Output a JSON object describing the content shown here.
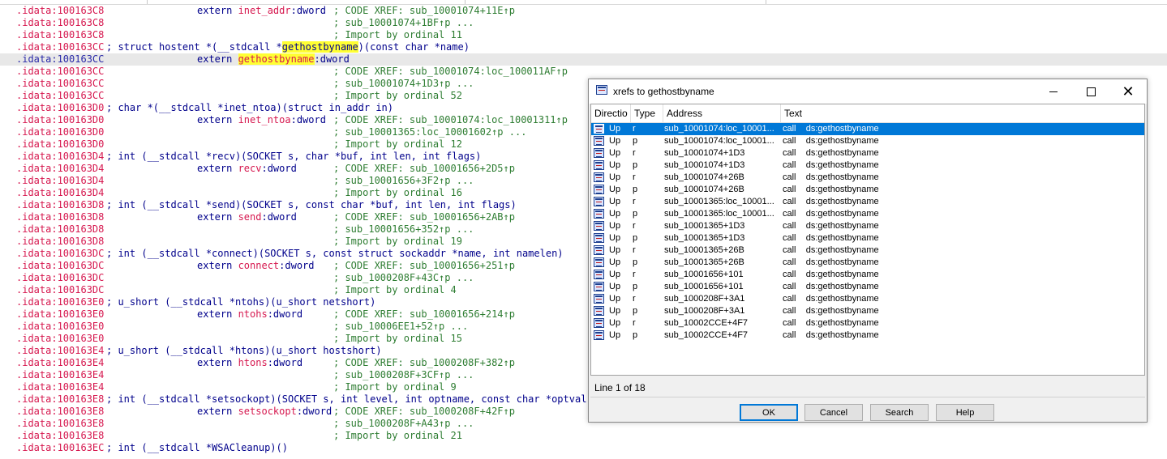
{
  "listing": {
    "lines": [
      {
        "type": "extern",
        "addr": ".idata:100163C8",
        "name": "inet_addr",
        "suffix": ":dword",
        "comment": "; CODE XREF: sub_10001074+11E↑p"
      },
      {
        "type": "cont",
        "addr": ".idata:100163C8",
        "comment": "; sub_10001074+1BF↑p ..."
      },
      {
        "type": "cont",
        "addr": ".idata:100163C8",
        "comment": "; Import by ordinal 11"
      },
      {
        "type": "decl",
        "addr": ".idata:100163CC",
        "pre": "; struct hostent *(__stdcall *",
        "mark": "gethostbyname",
        "post": ")(const char *name)"
      },
      {
        "type": "extern",
        "addr": ".idata:100163CC",
        "name": "gethostbyname",
        "suffix": ":dword",
        "comment": "",
        "current": true,
        "mark": true
      },
      {
        "type": "cont",
        "addr": ".idata:100163CC",
        "comment": "; CODE XREF: sub_10001074:loc_100011AF↑p"
      },
      {
        "type": "cont",
        "addr": ".idata:100163CC",
        "comment": "; sub_10001074+1D3↑p ..."
      },
      {
        "type": "cont",
        "addr": ".idata:100163CC",
        "comment": "; Import by ordinal 52"
      },
      {
        "type": "decl",
        "addr": ".idata:100163D0",
        "pre": "; char *(__stdcall *inet_ntoa)(struct in_addr in)"
      },
      {
        "type": "extern",
        "addr": ".idata:100163D0",
        "name": "inet_ntoa",
        "suffix": ":dword",
        "comment": "; CODE XREF: sub_10001074:loc_10001311↑p"
      },
      {
        "type": "cont",
        "addr": ".idata:100163D0",
        "comment": "; sub_10001365:loc_10001602↑p ..."
      },
      {
        "type": "cont",
        "addr": ".idata:100163D0",
        "comment": "; Import by ordinal 12"
      },
      {
        "type": "decl",
        "addr": ".idata:100163D4",
        "pre": "; int (__stdcall *recv)(SOCKET s, char *buf, int len, int flags)"
      },
      {
        "type": "extern",
        "addr": ".idata:100163D4",
        "name": "recv",
        "suffix": ":dword",
        "comment": "; CODE XREF: sub_10001656+2D5↑p"
      },
      {
        "type": "cont",
        "addr": ".idata:100163D4",
        "comment": "; sub_10001656+3F2↑p ..."
      },
      {
        "type": "cont",
        "addr": ".idata:100163D4",
        "comment": "; Import by ordinal 16"
      },
      {
        "type": "decl",
        "addr": ".idata:100163D8",
        "pre": "; int (__stdcall *send)(SOCKET s, const char *buf, int len, int flags)"
      },
      {
        "type": "extern",
        "addr": ".idata:100163D8",
        "name": "send",
        "suffix": ":dword",
        "comment": "; CODE XREF: sub_10001656+2AB↑p"
      },
      {
        "type": "cont",
        "addr": ".idata:100163D8",
        "comment": "; sub_10001656+352↑p ..."
      },
      {
        "type": "cont",
        "addr": ".idata:100163D8",
        "comment": "; Import by ordinal 19"
      },
      {
        "type": "decl",
        "addr": ".idata:100163DC",
        "pre": "; int (__stdcall *connect)(SOCKET s, const struct sockaddr *name, int namelen)"
      },
      {
        "type": "extern",
        "addr": ".idata:100163DC",
        "name": "connect",
        "suffix": ":dword",
        "comment": "; CODE XREF: sub_10001656+251↑p"
      },
      {
        "type": "cont",
        "addr": ".idata:100163DC",
        "comment": "; sub_1000208F+43C↑p ..."
      },
      {
        "type": "cont",
        "addr": ".idata:100163DC",
        "comment": "; Import by ordinal 4"
      },
      {
        "type": "decl",
        "addr": ".idata:100163E0",
        "pre": "; u_short (__stdcall *ntohs)(u_short netshort)"
      },
      {
        "type": "extern",
        "addr": ".idata:100163E0",
        "name": "ntohs",
        "suffix": ":dword",
        "comment": "; CODE XREF: sub_10001656+214↑p"
      },
      {
        "type": "cont",
        "addr": ".idata:100163E0",
        "comment": "; sub_10006EE1+52↑p ..."
      },
      {
        "type": "cont",
        "addr": ".idata:100163E0",
        "comment": "; Import by ordinal 15"
      },
      {
        "type": "decl",
        "addr": ".idata:100163E4",
        "pre": "; u_short (__stdcall *htons)(u_short hostshort)"
      },
      {
        "type": "extern",
        "addr": ".idata:100163E4",
        "name": "htons",
        "suffix": ":dword",
        "comment": "; CODE XREF: sub_1000208F+382↑p"
      },
      {
        "type": "cont",
        "addr": ".idata:100163E4",
        "comment": "; sub_1000208F+3CF↑p ..."
      },
      {
        "type": "cont",
        "addr": ".idata:100163E4",
        "comment": "; Import by ordinal 9"
      },
      {
        "type": "decl",
        "addr": ".idata:100163E8",
        "pre": "; int (__stdcall *setsockopt)(SOCKET s, int level, int optname, const char *optval, i"
      },
      {
        "type": "extern",
        "addr": ".idata:100163E8",
        "name": "setsockopt",
        "suffix": ":dword",
        "comment": "; CODE XREF: sub_1000208F+42F↑p"
      },
      {
        "type": "cont",
        "addr": ".idata:100163E8",
        "comment": "; sub_1000208F+A43↑p ..."
      },
      {
        "type": "cont",
        "addr": ".idata:100163E8",
        "comment": "; Import by ordinal 21"
      },
      {
        "type": "decl",
        "addr": ".idata:100163EC",
        "pre": "; int (__stdcall *WSACleanup)()"
      }
    ]
  },
  "dialog": {
    "title": "xrefs to gethostbyname",
    "columns": [
      "Directio",
      "Type",
      "Address",
      "Text"
    ],
    "rows": [
      {
        "dir": "Up",
        "type": "r",
        "address": "sub_10001074:loc_10001...",
        "text": "call    ds:gethostbyname",
        "selected": true
      },
      {
        "dir": "Up",
        "type": "p",
        "address": "sub_10001074:loc_10001...",
        "text": "call    ds:gethostbyname"
      },
      {
        "dir": "Up",
        "type": "r",
        "address": "sub_10001074+1D3",
        "text": "call    ds:gethostbyname"
      },
      {
        "dir": "Up",
        "type": "p",
        "address": "sub_10001074+1D3",
        "text": "call    ds:gethostbyname"
      },
      {
        "dir": "Up",
        "type": "r",
        "address": "sub_10001074+26B",
        "text": "call    ds:gethostbyname"
      },
      {
        "dir": "Up",
        "type": "p",
        "address": "sub_10001074+26B",
        "text": "call    ds:gethostbyname"
      },
      {
        "dir": "Up",
        "type": "r",
        "address": "sub_10001365:loc_10001...",
        "text": "call    ds:gethostbyname"
      },
      {
        "dir": "Up",
        "type": "p",
        "address": "sub_10001365:loc_10001...",
        "text": "call    ds:gethostbyname"
      },
      {
        "dir": "Up",
        "type": "r",
        "address": "sub_10001365+1D3",
        "text": "call    ds:gethostbyname"
      },
      {
        "dir": "Up",
        "type": "p",
        "address": "sub_10001365+1D3",
        "text": "call    ds:gethostbyname"
      },
      {
        "dir": "Up",
        "type": "r",
        "address": "sub_10001365+26B",
        "text": "call    ds:gethostbyname"
      },
      {
        "dir": "Up",
        "type": "p",
        "address": "sub_10001365+26B",
        "text": "call    ds:gethostbyname"
      },
      {
        "dir": "Up",
        "type": "r",
        "address": "sub_10001656+101",
        "text": "call    ds:gethostbyname"
      },
      {
        "dir": "Up",
        "type": "p",
        "address": "sub_10001656+101",
        "text": "call    ds:gethostbyname"
      },
      {
        "dir": "Up",
        "type": "r",
        "address": "sub_1000208F+3A1",
        "text": "call    ds:gethostbyname"
      },
      {
        "dir": "Up",
        "type": "p",
        "address": "sub_1000208F+3A1",
        "text": "call    ds:gethostbyname"
      },
      {
        "dir": "Up",
        "type": "r",
        "address": "sub_10002CCE+4F7",
        "text": "call    ds:gethostbyname"
      },
      {
        "dir": "Up",
        "type": "p",
        "address": "sub_10002CCE+4F7",
        "text": "call    ds:gethostbyname"
      }
    ],
    "status": "Line 1 of 18",
    "buttons": {
      "ok": "OK",
      "cancel": "Cancel",
      "search": "Search",
      "help": "Help"
    },
    "window_controls": {
      "minimize": "—",
      "maximize": "☐",
      "close": "✕"
    }
  },
  "colors": {
    "address": "#d6184f",
    "keyword": "#00008b",
    "comment": "#2e7d32",
    "highlight": "#ffff33",
    "selection": "#0078d7"
  },
  "icons": {
    "row": "xref-call-icon",
    "app": "ida-xref-window-icon"
  }
}
